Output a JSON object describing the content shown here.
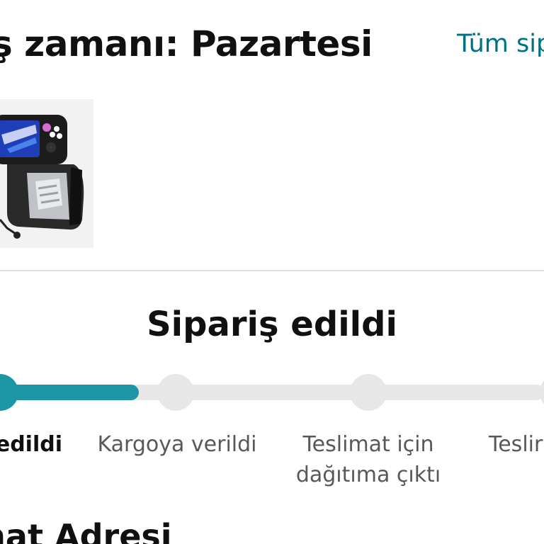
{
  "header": {
    "delivery_title": "ş zamanı: Pazartesi",
    "all_orders_link": "Tüm sip"
  },
  "product": {
    "image_icon": "handheld-console-case-icon"
  },
  "tracking": {
    "status_heading": "Sipariş edildi",
    "progress_fraction": 0.25,
    "steps": [
      {
        "label_line1": "edildi",
        "label_line2": "",
        "state": "done"
      },
      {
        "label_line1": "Kargoya verildi",
        "label_line2": "",
        "state": "pending"
      },
      {
        "label_line1": "Teslimat için",
        "label_line2": "dağıtıma çıktı",
        "state": "pending"
      },
      {
        "label_line1": "Teslir",
        "label_line2": "",
        "state": "pending"
      }
    ],
    "colors": {
      "progress": "#1c96a7",
      "track": "#e7e7e7"
    }
  },
  "address": {
    "heading": "mat Adresi"
  },
  "colors": {
    "text": "#0f1111",
    "link": "#007185",
    "muted": "#565959"
  }
}
